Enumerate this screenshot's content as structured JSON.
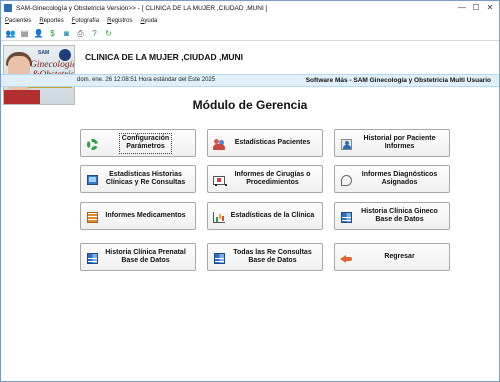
{
  "window": {
    "title": "SAM-Ginecología y Obstetricia Versión>> - [ CLINICA DE LA MUJER ,CIUDAD ,MUNI ]",
    "controls": [
      "—",
      "☐",
      "✕"
    ]
  },
  "menu": {
    "items": [
      {
        "u": "P",
        "rest": "acientes"
      },
      {
        "u": "R",
        "rest": "eportes"
      },
      {
        "u": "F",
        "rest": "otografía"
      },
      {
        "u": "R",
        "rest": "egistros"
      },
      {
        "u": "A",
        "rest": "yuda"
      }
    ]
  },
  "toolbar": {
    "icons": [
      {
        "name": "patients-icon",
        "glyph": "👥",
        "color": "#3b8fd6"
      },
      {
        "name": "document-icon",
        "glyph": "▤",
        "color": "#4a4a4a"
      },
      {
        "name": "users-icon",
        "glyph": "👤",
        "color": "#2b6fb0"
      },
      {
        "name": "money-icon",
        "glyph": "$",
        "color": "#2e9d3e"
      },
      {
        "name": "camera-icon",
        "glyph": "◙",
        "color": "#1f8fa8"
      },
      {
        "name": "printer-icon",
        "glyph": "⎙",
        "color": "#555555"
      },
      {
        "name": "help-icon",
        "glyph": "?",
        "color": "#2b6fb0"
      },
      {
        "name": "refresh-icon",
        "glyph": "↻",
        "color": "#2e9d3e"
      }
    ]
  },
  "banner": {
    "logo_sam": "SAM",
    "logo_line1": "Ginecología",
    "logo_line2": "&Obstetricia",
    "clinic_name": "CLINICA DE LA MUJER ,CIUDAD ,MUNI"
  },
  "status": {
    "datetime": "dom. ene. 26 12:08:51 Hora estándar del Este 2025",
    "app_name": "Software Más - SAM Ginecología y Obstetricia Multi Usuario"
  },
  "main": {
    "title": "Módulo de Gerencia",
    "buttons": [
      {
        "label": "Configuración\nParámetros",
        "icon": "ico-gear"
      },
      {
        "label": "Estadísticas Pacientes",
        "icon": "ico-people"
      },
      {
        "label": "Historial por Paciente\nInformes",
        "icon": "ico-person"
      },
      {
        "label": "Estadísticas Historias\nClínicas y Re Consultas",
        "icon": "ico-monitor"
      },
      {
        "label": "Informes de Cirugías o\nProcedimientos",
        "icon": "ico-ambulance"
      },
      {
        "label": "Informes Diagnósticos\nAsignados",
        "icon": "ico-stetho"
      },
      {
        "label": "Informes  Medicamentos",
        "icon": "ico-grid-orange"
      },
      {
        "label": "Estadísticas de la Clínica",
        "icon": "ico-bars"
      },
      {
        "label": "Historia Clínica Gineco\nBase de Datos",
        "icon": "ico-grid-blue"
      },
      {
        "label": "Historia Clínica Prenatal\nBase de Datos",
        "icon": "ico-grid-blue"
      },
      {
        "label": "Todas las Re Consultas\nBase de Datos",
        "icon": "ico-grid-blue"
      },
      {
        "label": "Regresar",
        "icon": "ico-back"
      }
    ]
  }
}
